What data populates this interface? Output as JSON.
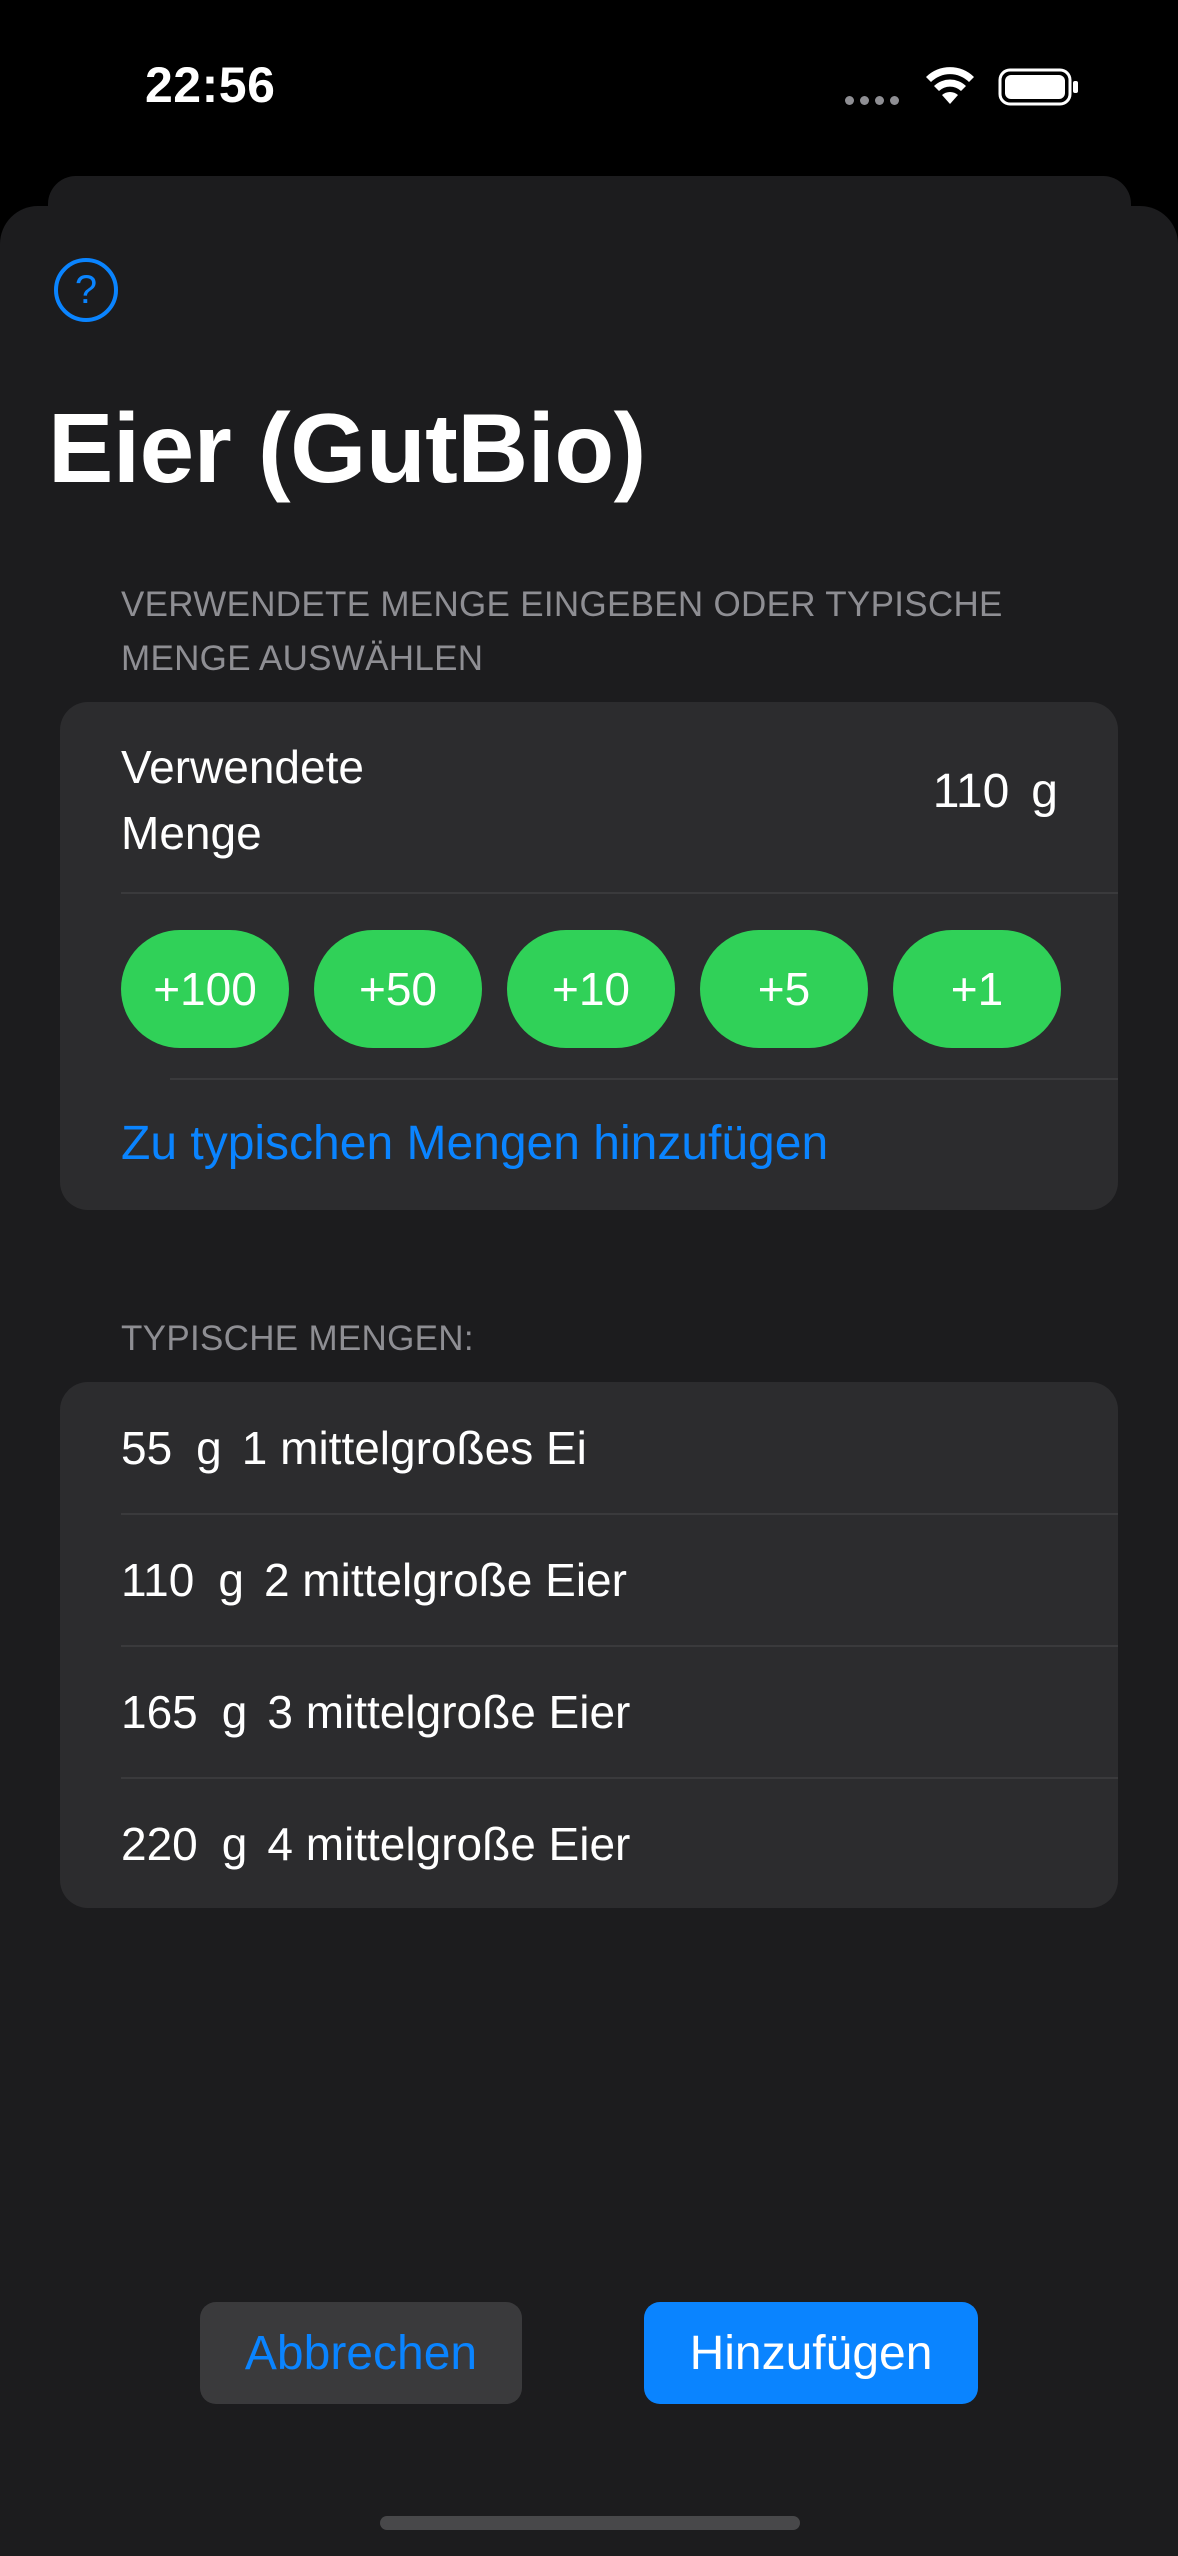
{
  "status_bar": {
    "time": "22:56"
  },
  "header": {
    "title": "Eier (GutBio)",
    "help_icon_glyph": "?"
  },
  "amount_section": {
    "header": "VERWENDETE MENGE EINGEBEN ODER TYPISCHE MENGE AUSWÄHLEN",
    "label": "Verwendete Menge",
    "value": "110",
    "unit": "g",
    "increments": [
      "+100",
      "+50",
      "+10",
      "+5",
      "+1"
    ],
    "add_to_typical": "Zu typischen Mengen hinzufügen"
  },
  "typical_section": {
    "header": "TYPISCHE MENGEN:",
    "items": [
      {
        "amount": "55",
        "unit": "g",
        "description": "1 mittelgroßes Ei"
      },
      {
        "amount": "110",
        "unit": "g",
        "description": "2 mittelgroße Eier"
      },
      {
        "amount": "165",
        "unit": "g",
        "description": "3 mittelgroße Eier"
      },
      {
        "amount": "220",
        "unit": "g",
        "description": "4 mittelgroße Eier"
      }
    ]
  },
  "footer": {
    "cancel_label": "Abbrechen",
    "add_label": "Hinzufügen"
  },
  "colors": {
    "accent": "#0a84ff",
    "increment_green": "#30d158",
    "sheet_bg": "#1c1c1e",
    "group_bg": "#2c2c2e"
  }
}
